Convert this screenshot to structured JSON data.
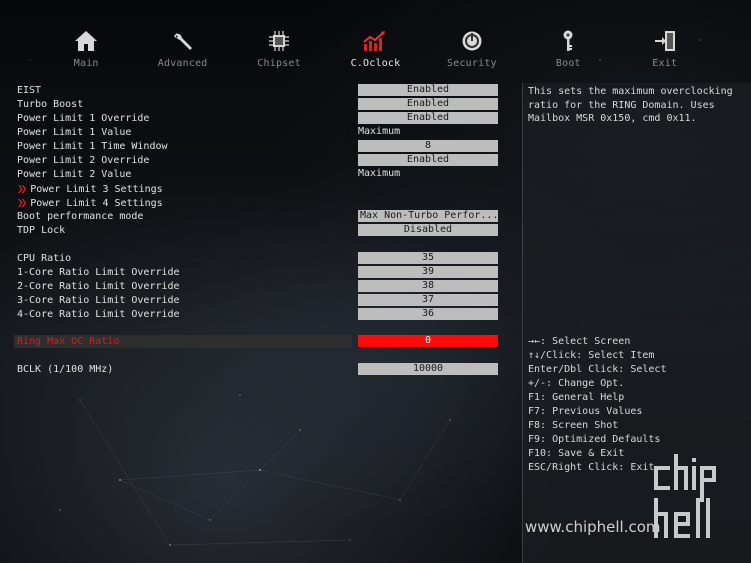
{
  "nav": [
    {
      "label": "Main",
      "icon": "home-icon"
    },
    {
      "label": "Advanced",
      "icon": "wrench-icon"
    },
    {
      "label": "Chipset",
      "icon": "chip-icon"
    },
    {
      "label": "C.Oclock",
      "icon": "overclock-chart-icon",
      "active": true
    },
    {
      "label": "Security",
      "icon": "shield-power-icon"
    },
    {
      "label": "Boot",
      "icon": "key-icon"
    },
    {
      "label": "Exit",
      "icon": "exit-door-icon"
    }
  ],
  "settings": {
    "eist": {
      "label": "EIST",
      "value": "Enabled"
    },
    "turbo_boost": {
      "label": "Turbo Boost",
      "value": "Enabled"
    },
    "pl1_override": {
      "label": "Power Limit 1 Override",
      "value": "Enabled"
    },
    "pl1_value": {
      "label": "Power Limit 1 Value",
      "value": "Maximum"
    },
    "pl1_time": {
      "label": "Power Limit 1 Time Window",
      "value": "8"
    },
    "pl2_override": {
      "label": "Power Limit 2 Override",
      "value": "Enabled"
    },
    "pl2_value": {
      "label": "Power Limit 2 Value",
      "value": "Maximum"
    },
    "pl3_settings": {
      "label": "Power Limit 3 Settings"
    },
    "pl4_settings": {
      "label": "Power Limit 4 Settings"
    },
    "boot_perf": {
      "label": "Boot performance mode",
      "value": "Max Non-Turbo Perfor..."
    },
    "tdp_lock": {
      "label": "TDP Lock",
      "value": "Disabled"
    },
    "cpu_ratio": {
      "label": "CPU Ratio",
      "value": "35"
    },
    "core1": {
      "label": "1-Core Ratio Limit Override",
      "value": "39"
    },
    "core2": {
      "label": "2-Core Ratio Limit Override",
      "value": "38"
    },
    "core3": {
      "label": "3-Core Ratio Limit Override",
      "value": "37"
    },
    "core4": {
      "label": "4-Core Ratio Limit Override",
      "value": "36"
    },
    "ring_max": {
      "label": "Ring Max OC Ratio",
      "value": "0"
    },
    "bclk": {
      "label": "BCLK  (1/100 MHz)",
      "value": "10000"
    }
  },
  "help_text": "This sets the maximum overclocking ratio for the RING Domain. Uses Mailbox MSR 0x150, cmd 0x11.",
  "keys": [
    "→←: Select Screen",
    "↑↓/Click: Select Item",
    "Enter/Dbl Click: Select",
    "+/-: Change Opt.",
    "F1: General Help",
    "F7: Previous Values",
    "F8: Screen Shot",
    "F9: Optimized Defaults",
    "F10: Save & Exit",
    "ESC/Right Click: Exit"
  ],
  "watermark": {
    "url": "www.chiphell.com",
    "logo_text": "chip hell"
  },
  "colors": {
    "accent": "#ff0a0a",
    "value_box": "#bdbdbd",
    "text": "#e0e0e0"
  }
}
